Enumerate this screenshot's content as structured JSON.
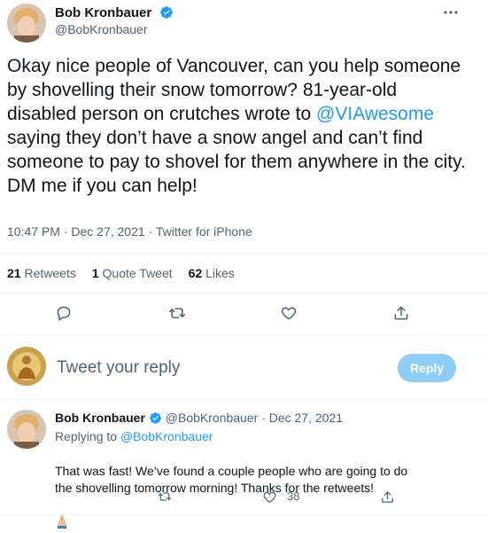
{
  "tweet": {
    "author_name": "Bob Kronbauer",
    "author_handle": "@BobKronbauer",
    "text_before_mention": "Okay nice people of Vancouver, can you help someone by shovelling their snow tomorrow? 81-year-old disabled person on crutches wrote to ",
    "mention": "@VIAwesome",
    "text_after_mention": " saying they don’t have a snow angel and can’t find someone to pay to shovel for them anywhere in the city.\nDM me if you can help!",
    "timestamp": "10:47 PM · Dec 27, 2021 · Twitter for iPhone",
    "stats": {
      "retweets_count": "21",
      "retweets_label": "Retweets",
      "quotes_count": "1",
      "quotes_label": "Quote Tweet",
      "likes_count": "62",
      "likes_label": "Likes"
    },
    "more_icon": "more-dots-icon"
  },
  "composer": {
    "placeholder": "Tweet your reply",
    "button_label": "Reply"
  },
  "reply": {
    "author_name": "Bob Kronbauer",
    "author_handle": "@BobKronbauer",
    "date": "· Dec 27, 2021",
    "replying_to_label": "Replying to",
    "replying_to_handle": "@BobKronbauer",
    "text": "That was fast! We’ve found a couple people who are going to do the shovelling tomorrow morning! Thanks for the retweets!",
    "like_count": "38"
  },
  "colors": {
    "accent": "#1d9bf0",
    "text": "#0f1419",
    "muted": "#536471",
    "reply_button": "#8ecdf8"
  }
}
